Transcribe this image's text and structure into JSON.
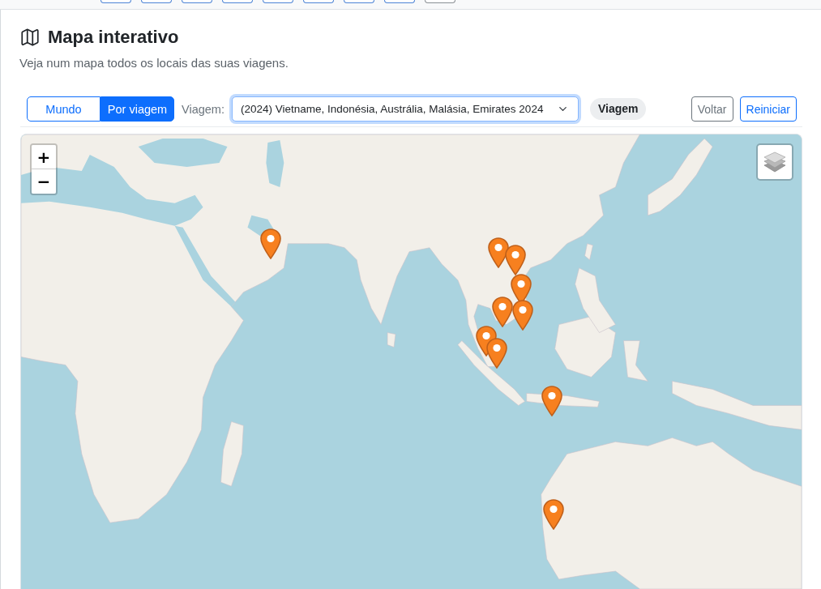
{
  "top_bar": {
    "buttons": [
      {
        "kind": "primary"
      },
      {
        "kind": "primary"
      },
      {
        "kind": "primary"
      },
      {
        "kind": "primary"
      },
      {
        "kind": "primary"
      },
      {
        "kind": "primary"
      },
      {
        "kind": "primary"
      },
      {
        "kind": "primary"
      },
      {
        "kind": "secondary"
      }
    ]
  },
  "header": {
    "title": "Mapa interativo",
    "subtitle": "Veja num mapa todos os locais das suas viagens."
  },
  "toolbar": {
    "view_toggle": [
      {
        "label": "Mundo",
        "selected": false
      },
      {
        "label": "Por viagem",
        "selected": true
      }
    ],
    "trip_label": "Viagem:",
    "trip_select": {
      "value": "(2024) Vietname, Indonésia, Austrália, Malásia, Emirates 2024",
      "focused": true
    },
    "badge": "Viagem",
    "buttons": [
      {
        "label": "Voltar",
        "kind": "secondary"
      },
      {
        "label": "Reiniciar",
        "kind": "primary"
      }
    ]
  },
  "map": {
    "zoom_controls": [
      "+",
      "−"
    ]
  }
}
